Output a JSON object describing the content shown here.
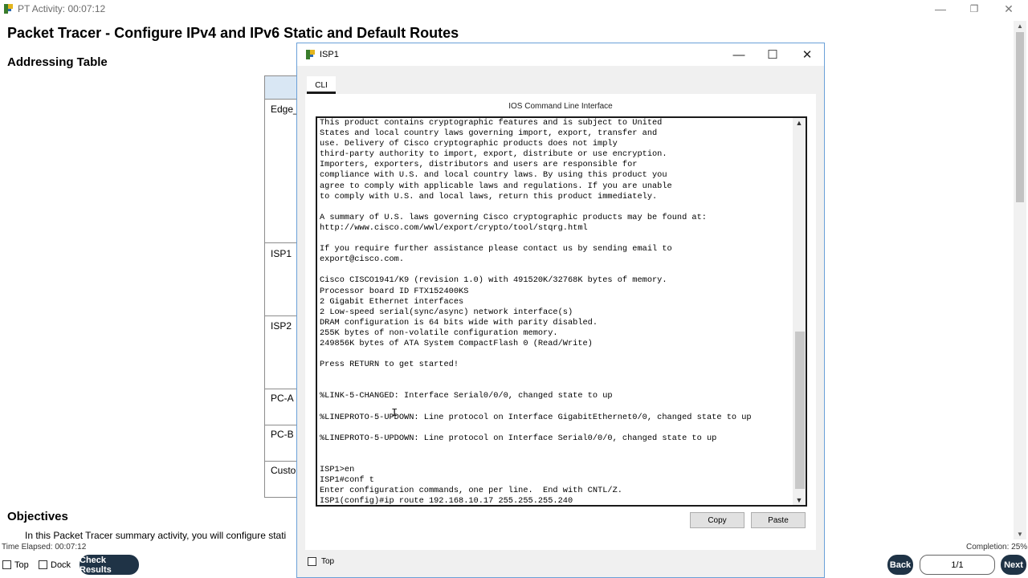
{
  "main_window": {
    "title": "PT Activity: 00:07:12",
    "controls": {
      "minimize": "—",
      "restore": "❐",
      "close": "✕"
    }
  },
  "document": {
    "title": "Packet Tracer - Configure IPv4 and IPv6 Static and Default Routes",
    "addressing_table_heading": "Addressing Table",
    "table_rows": [
      "Edge_",
      "ISP1",
      "ISP2",
      "PC-A",
      "PC-B",
      "Custo"
    ],
    "objectives_heading": "Objectives",
    "objectives_text": "In this Packet Tracer summary activity, you will configure stati"
  },
  "status_bar": {
    "time_elapsed": "Time Elapsed: 00:07:12",
    "completion": "Completion: 25%",
    "top_label": "Top",
    "dock_label": "Dock",
    "check_results_label": "Check Results",
    "back_label": "Back",
    "page_indicator": "1/1",
    "next_label": "Next"
  },
  "dialog": {
    "title": "ISP1",
    "controls": {
      "minimize": "—",
      "maximize": "☐",
      "close": "✕"
    },
    "tab_label": "CLI",
    "cli_header": "IOS Command Line Interface",
    "terminal_lines": [
      "This product contains cryptographic features and is subject to United",
      "States and local country laws governing import, export, transfer and",
      "use. Delivery of Cisco cryptographic products does not imply",
      "third-party authority to import, export, distribute or use encryption.",
      "Importers, exporters, distributors and users are responsible for",
      "compliance with U.S. and local country laws. By using this product you",
      "agree to comply with applicable laws and regulations. If you are unable",
      "to comply with U.S. and local laws, return this product immediately.",
      "",
      "A summary of U.S. laws governing Cisco cryptographic products may be found at:",
      "http://www.cisco.com/wwl/export/crypto/tool/stqrg.html",
      "",
      "If you require further assistance please contact us by sending email to",
      "export@cisco.com.",
      "",
      "Cisco CISCO1941/K9 (revision 1.0) with 491520K/32768K bytes of memory.",
      "Processor board ID FTX152400KS",
      "2 Gigabit Ethernet interfaces",
      "2 Low-speed serial(sync/async) network interface(s)",
      "DRAM configuration is 64 bits wide with parity disabled.",
      "255K bytes of non-volatile configuration memory.",
      "249856K bytes of ATA System CompactFlash 0 (Read/Write)",
      "",
      "Press RETURN to get started!",
      "",
      "",
      "%LINK-5-CHANGED: Interface Serial0/0/0, changed state to up",
      "",
      "%LINEPROTO-5-UPDOWN: Line protocol on Interface GigabitEthernet0/0, changed state to up",
      "",
      "%LINEPROTO-5-UPDOWN: Line protocol on Interface Serial0/0/0, changed state to up",
      "",
      "",
      "ISP1>en",
      "ISP1#conf t",
      "Enter configuration commands, one per line.  End with CNTL/Z.",
      "ISP1(config)#ip route 192.168.10.17 255.255.255.240"
    ],
    "copy_label": "Copy",
    "paste_label": "Paste",
    "top_label": "Top"
  },
  "colors": {
    "accent_pill": "#1f3346",
    "table_header": "#d9e7f4",
    "dialog_border": "#6aa0d8"
  }
}
